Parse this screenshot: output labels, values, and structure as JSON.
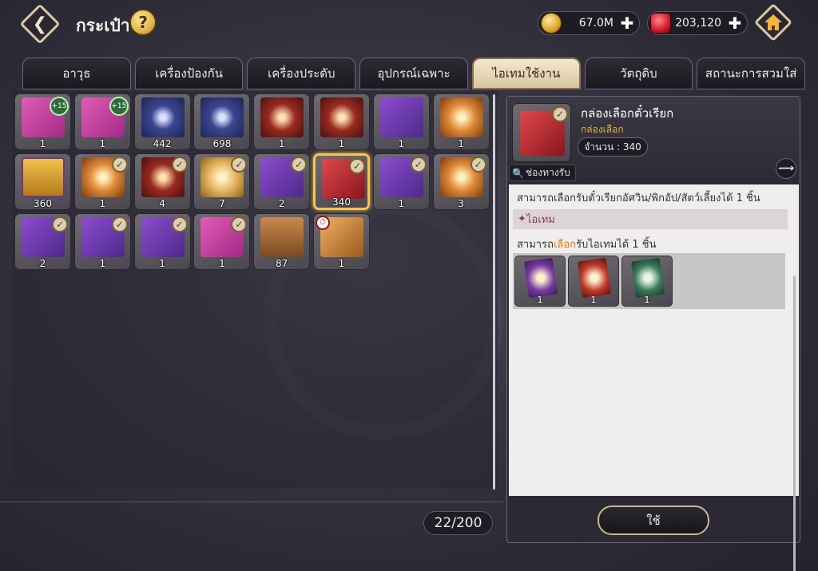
{
  "header": {
    "title": "กระเป๋า",
    "help_label": "?",
    "gold_value": "67.0M",
    "gem_value": "203,120"
  },
  "tabs": [
    {
      "label": "อาวุธ",
      "active": false
    },
    {
      "label": "เครื่องป้องกัน",
      "active": false
    },
    {
      "label": "เครื่องประดับ",
      "active": false
    },
    {
      "label": "อุปกรณ์เฉพาะ",
      "active": false
    },
    {
      "label": "ไอเทมใช้งาน",
      "active": true
    },
    {
      "label": "วัตถุดิบ",
      "active": false
    },
    {
      "label": "สถานะการสวมใส่",
      "active": false
    }
  ],
  "items": [
    {
      "count": "1",
      "art": "pinkbox",
      "badge": "+15"
    },
    {
      "count": "1",
      "art": "pinkbox",
      "badge": "+15"
    },
    {
      "count": "442",
      "art": "bluecard"
    },
    {
      "count": "698",
      "art": "bluecard"
    },
    {
      "count": "1",
      "art": "redcard"
    },
    {
      "count": "1",
      "art": "redcard"
    },
    {
      "count": "1",
      "art": "purplebox"
    },
    {
      "count": "1",
      "art": "orangecard"
    },
    {
      "count": "360",
      "art": "chest"
    },
    {
      "count": "1",
      "art": "orangecard",
      "check": true
    },
    {
      "count": "4",
      "art": "redcard",
      "check": true
    },
    {
      "count": "7",
      "art": "goldcard",
      "check": true
    },
    {
      "count": "2",
      "art": "purplebox",
      "check": true
    },
    {
      "count": "340",
      "art": "redbox",
      "check": true,
      "selected": true
    },
    {
      "count": "1",
      "art": "purplebox",
      "check": true
    },
    {
      "count": "3",
      "art": "orangecard",
      "check": true
    },
    {
      "count": "2",
      "art": "purplebox",
      "check": true
    },
    {
      "count": "1",
      "art": "purplebox",
      "check": true
    },
    {
      "count": "1",
      "art": "purplebox",
      "check": true
    },
    {
      "count": "1",
      "art": "pinkbox",
      "check": true
    },
    {
      "count": "87",
      "art": "woodchest"
    },
    {
      "count": "1",
      "art": "portrait",
      "timer": true
    }
  ],
  "inventory": {
    "capacity": "22/200"
  },
  "detail": {
    "name": "กล่องเลือกตั๋วเรียก",
    "type": "กล่องเลือก",
    "quantity": "จำนวน : 340",
    "route_label": "ช่องทางรับ",
    "description": "สามารถเลือกรับตั๋วเรียกอัศวิน/พิกอัป/สัตว์เลี้ยงได้ 1 ชิ้น",
    "section_label": "ไอเทม",
    "choose_prefix": "สามารถ",
    "choose_highlight": "เลือก",
    "choose_suffix": "รับไอเทมได้ 1 ชิ้น",
    "rewards": [
      {
        "count": "1",
        "art": "card-purple"
      },
      {
        "count": "1",
        "art": "card-red"
      },
      {
        "count": "1",
        "art": "card-green"
      }
    ],
    "use_label": "ใช้"
  }
}
